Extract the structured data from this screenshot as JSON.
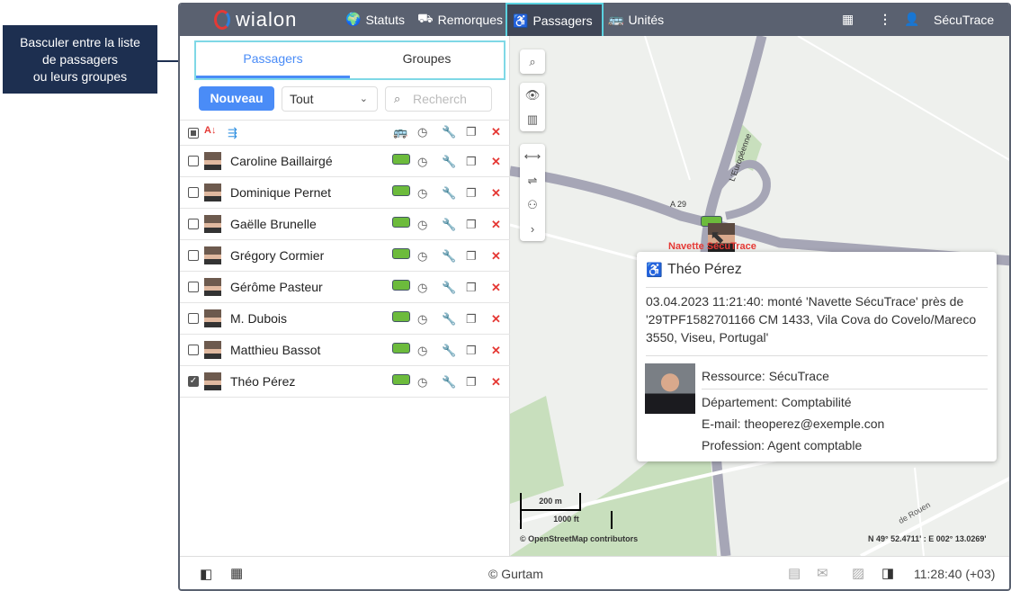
{
  "callout": {
    "text_line1": "Basculer entre la liste",
    "text_line2": "de passagers",
    "text_line3": "ou leurs groupes"
  },
  "header": {
    "logo": "wialon",
    "nav": [
      {
        "label": "Statuts",
        "icon": "globe-icon"
      },
      {
        "label": "Remorques",
        "icon": "trailer-icon"
      },
      {
        "label": "Passagers",
        "icon": "passenger-icon"
      },
      {
        "label": "Unités",
        "icon": "bus-icon"
      }
    ],
    "user": "SécuTrace"
  },
  "panel": {
    "tabs": [
      "Passagers",
      "Groupes"
    ],
    "new_button": "Nouveau",
    "filter": "Tout",
    "search_placeholder": "Recherch"
  },
  "passengers": [
    {
      "name": "Caroline Baillairgé",
      "checked": false
    },
    {
      "name": "Dominique Pernet",
      "checked": false
    },
    {
      "name": "Gaëlle Brunelle",
      "checked": false
    },
    {
      "name": "Grégory Cormier",
      "checked": false
    },
    {
      "name": "Gérôme Pasteur",
      "checked": false
    },
    {
      "name": "M. Dubois",
      "checked": false
    },
    {
      "name": "Matthieu Bassot",
      "checked": false
    },
    {
      "name": "Théo Pérez",
      "checked": true
    }
  ],
  "map": {
    "road_label": "A 29",
    "road_label2": "L'Européenne",
    "unit_label": "Navette SécuTrace",
    "street": "de Rouen",
    "scale_m": "200 m",
    "scale_ft": "1000 ft",
    "attribution": "© OpenStreetMap contributors",
    "coordinates": "N 49° 52.4711' : E 002° 13.0269'"
  },
  "popup": {
    "name": "Théo Pérez",
    "message": "03.04.2023 11:21:40: monté 'Navette SécuTrace' près de '29TPF1582701166 CM 1433, Vila Cova do Covelo/Mareco 3550, Viseu, Portugal'",
    "props": [
      {
        "label": "Ressource:",
        "value": "SécuTrace"
      },
      {
        "label": "Département:",
        "value": "Comptabilité"
      },
      {
        "label": "E-mail:",
        "value": "theoperez@exemple.con"
      },
      {
        "label": "Profession:",
        "value": "Agent comptable"
      }
    ]
  },
  "footer": {
    "copyright": "© Gurtam",
    "time": "11:28:40 (+03)"
  }
}
